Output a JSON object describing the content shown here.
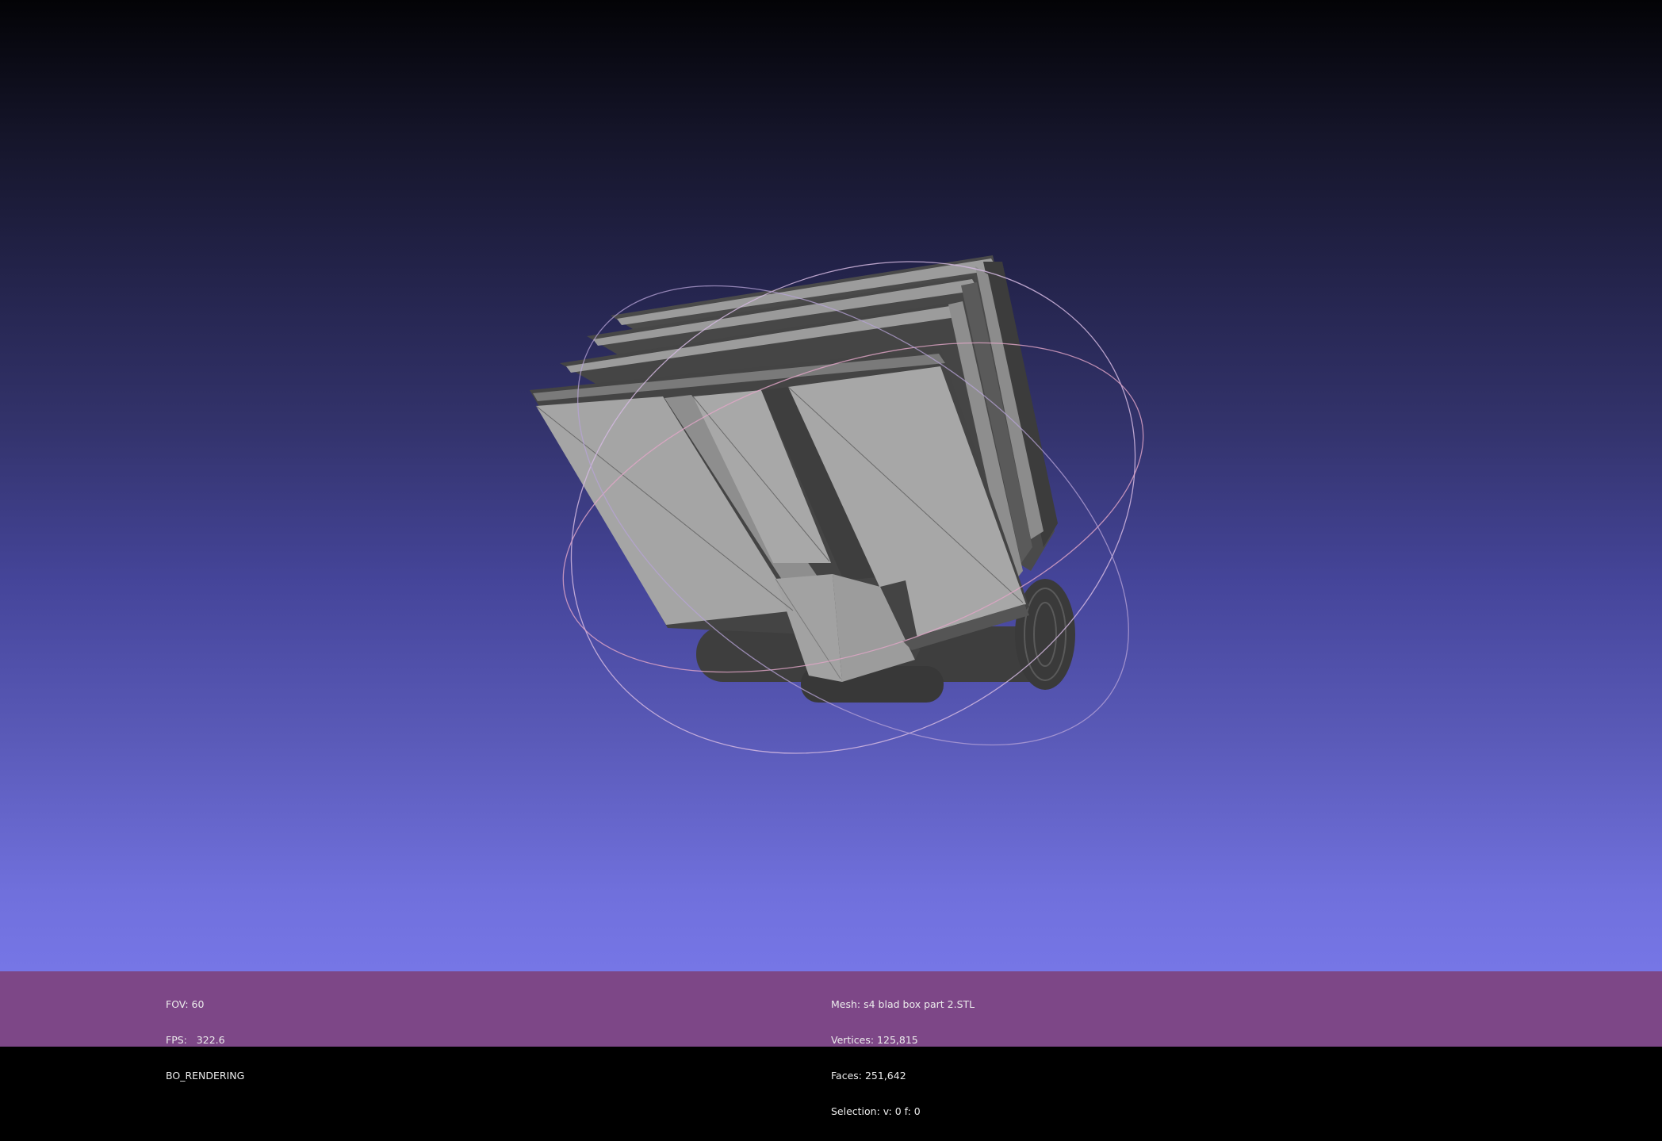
{
  "viewport": {
    "background_top": "#030306",
    "background_bottom": "#7676e6",
    "mesh_color": "#a6a6a6",
    "mesh_edge_color": "#454545",
    "trackball_colors": [
      "#c8b4dc",
      "#e0a8c8",
      "#b4a0d0"
    ]
  },
  "status": {
    "bar_color": "#7d4787",
    "fov": "FOV: 60",
    "fps": "FPS:   322.6",
    "render_mode": "BO_RENDERING",
    "mesh": "Mesh: s4 blad box part 2.STL",
    "vertices": "Vertices: 125,815",
    "faces": "Faces: 251,642",
    "selection": "Selection: v: 0 f: 0"
  }
}
